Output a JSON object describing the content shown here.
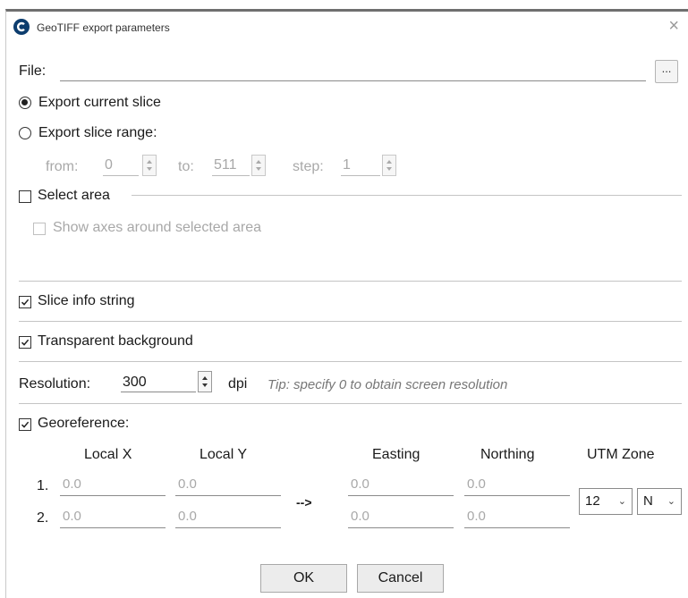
{
  "window": {
    "title": "GeoTIFF export parameters",
    "close_symbol": "×",
    "icon": "app-logo-icon"
  },
  "file": {
    "label": "File:",
    "value": "",
    "browse_label": "..."
  },
  "export_mode": {
    "current_slice_label": "Export current slice",
    "current_slice_checked": true,
    "slice_range_label": "Export slice range:",
    "slice_range_checked": false
  },
  "range": {
    "from_label": "from:",
    "from_value": "0",
    "to_label": "to:",
    "to_value": "511",
    "step_label": "step:",
    "step_value": "1"
  },
  "select_area": {
    "label": "Select area",
    "checked": false,
    "show_axes_label": "Show axes around selected area",
    "show_axes_checked": false
  },
  "options": {
    "slice_info_label": "Slice info string",
    "slice_info_checked": true,
    "transparent_bg_label": "Transparent background",
    "transparent_bg_checked": true
  },
  "resolution": {
    "label": "Resolution:",
    "value": "300",
    "unit": "dpi",
    "tip": "Tip: specify 0 to obtain screen resolution"
  },
  "georeference": {
    "label": "Georeference:",
    "checked": true,
    "columns": {
      "local_x": "Local X",
      "local_y": "Local Y",
      "easting": "Easting",
      "northing": "Northing",
      "utm_zone": "UTM Zone"
    },
    "arrow": "-->",
    "rows": [
      {
        "index": "1.",
        "local_x": "0.0",
        "local_y": "0.0",
        "easting": "0.0",
        "northing": "0.0"
      },
      {
        "index": "2.",
        "local_x": "0.0",
        "local_y": "0.0",
        "easting": "0.0",
        "northing": "0.0"
      }
    ],
    "utm_zone_value": "12",
    "hemisphere_value": "N"
  },
  "buttons": {
    "ok": "OK",
    "cancel": "Cancel"
  }
}
